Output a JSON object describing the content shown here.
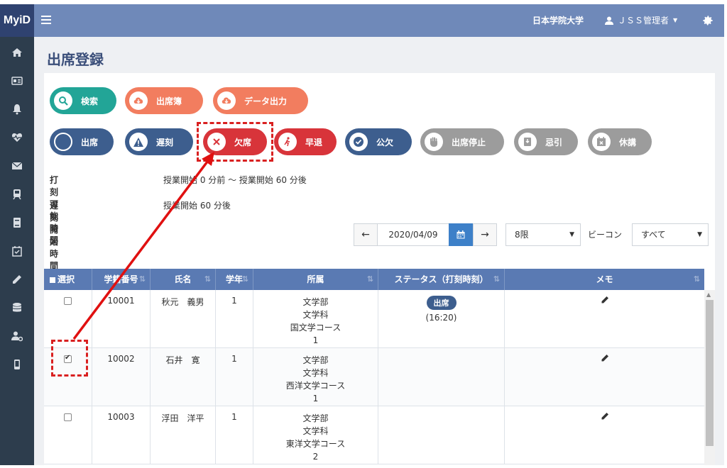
{
  "header": {
    "brand": "MyiD",
    "university": "日本学院大学",
    "user": "ＪＳＳ管理者"
  },
  "page": {
    "title": "出席登録"
  },
  "toolbar_top": [
    {
      "label": "検索",
      "icon": "search-icon",
      "color": "#22a597"
    },
    {
      "label": "出席簿",
      "icon": "cloud-download-icon",
      "color": "#f27d5f"
    },
    {
      "label": "データ出力",
      "icon": "cloud-download-icon",
      "color": "#f27d5f"
    }
  ],
  "status_buttons": [
    {
      "label": "出席",
      "icon": "circle-icon",
      "color": "#3d5e8e"
    },
    {
      "label": "遅刻",
      "icon": "warning-icon",
      "color": "#3d5e8e"
    },
    {
      "label": "欠席",
      "icon": "x-icon",
      "color": "#d8343a"
    },
    {
      "label": "早退",
      "icon": "running-person-icon",
      "color": "#d8343a"
    },
    {
      "label": "公欠",
      "icon": "check-circle-icon",
      "color": "#3d5e8e"
    },
    {
      "label": "出席停止",
      "icon": "hand-icon",
      "color": "#9c9c9c"
    },
    {
      "label": "忌引",
      "icon": "mourning-icon",
      "color": "#9c9c9c"
    },
    {
      "label": "休講",
      "icon": "calendar-x-icon",
      "color": "#9c9c9c"
    }
  ],
  "info": {
    "stamp_label": "打刻可能時間",
    "stamp_value": "授業開始 0 分前 〜 授業開始 60 分後",
    "late_label": "遅刻開始時間",
    "late_value": "授業開始 60 分後"
  },
  "filters": {
    "date": "2020/04/09",
    "period": "8限",
    "beacon_label": "ビーコン",
    "beacon_value": "すべて"
  },
  "table": {
    "headers": [
      "選択",
      "学籍番号",
      "氏名",
      "学年",
      "所属",
      "ステータス（打刻時刻）",
      "メモ"
    ],
    "rows": [
      {
        "checked": false,
        "id": "10001",
        "name": "秋元　義男",
        "year": "1",
        "aff1": "文学部",
        "aff2": "文学科",
        "aff3": "国文学コース",
        "aff4": "1",
        "status": "出席",
        "time": "(16:20)"
      },
      {
        "checked": true,
        "id": "10002",
        "name": "石井　寛",
        "year": "1",
        "aff1": "文学部",
        "aff2": "文学科",
        "aff3": "西洋文学コース",
        "aff4": "1",
        "status": "",
        "time": ""
      },
      {
        "checked": false,
        "id": "10003",
        "name": "浮田　洋平",
        "year": "1",
        "aff1": "文学部",
        "aff2": "文学科",
        "aff3": "東洋文学コース",
        "aff4": "2",
        "status": "",
        "time": ""
      }
    ]
  },
  "accent_colors": {
    "highlight": "#d92020",
    "header": "#6f89b9",
    "sidebar": "#2d3d4d"
  }
}
